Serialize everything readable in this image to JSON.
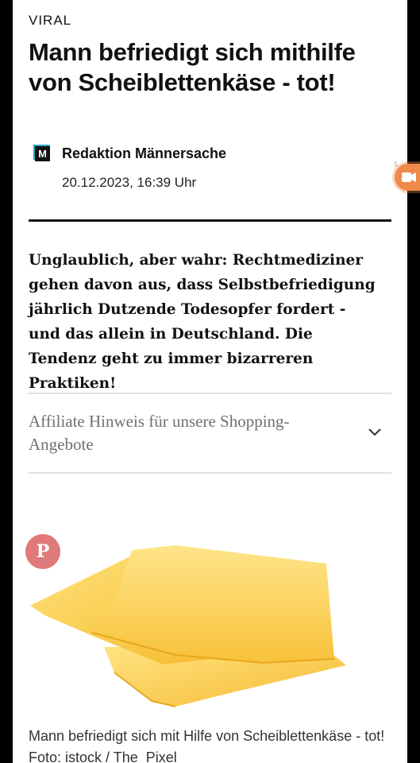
{
  "article": {
    "category": "VIRAL",
    "title": "Mann befriedigt sich mithilfe von Scheiblettenkäse - tot!",
    "author": "Redaktion Männersache",
    "author_logo_letter": "M",
    "date": "20.12.2023, 16:39 Uhr",
    "lead": "Unglaublich, aber wahr: Rechtmediziner gehen davon aus, dass Selbstbefriedigung jährlich Dutzende Todesopfer fordert - und das allein in Deutschland. Die Tendenz geht zu immer bizarreren Praktiken!",
    "affiliate_label": "Affiliate Hinweis für unsere Shopping-Angebote",
    "image_caption": "Mann befriedigt sich mit Hilfe von Scheiblettenkäse - tot!   Foto: istock / The_Pixel"
  },
  "overlay": {
    "float_count": "5"
  },
  "colors": {
    "pinterest_button": "#e07a7a",
    "float_button": "#f08a4b",
    "cheese_light": "#ffe27a",
    "cheese_dark": "#f5b82a"
  },
  "icons": {
    "pin": "pinterest-icon",
    "chevron": "chevron-down-icon",
    "float": "video-camera-icon"
  }
}
